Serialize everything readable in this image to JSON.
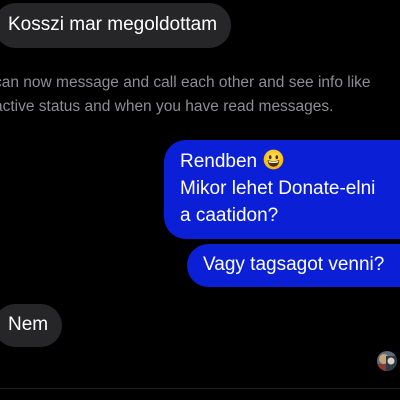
{
  "conversation": {
    "messages": [
      {
        "sender": "other",
        "text": "Kosszi mar megoldottam"
      },
      {
        "sender": "self",
        "lines": [
          "Rendben",
          "Mikor lehet Donate-elni",
          "a caatidon?"
        ],
        "emoji": "grinning-face"
      },
      {
        "sender": "self",
        "text": "Vagy tagsagot venni?"
      },
      {
        "sender": "other",
        "text": "Nem"
      }
    ],
    "notice_lines": [
      "can now message and call each other and see info like",
      "active status and when you have read messages."
    ]
  },
  "colors": {
    "background": "#000000",
    "incoming_bubble": "#262628",
    "outgoing_bubble": "#0a1fd6",
    "notice_text": "#8e8e93"
  }
}
